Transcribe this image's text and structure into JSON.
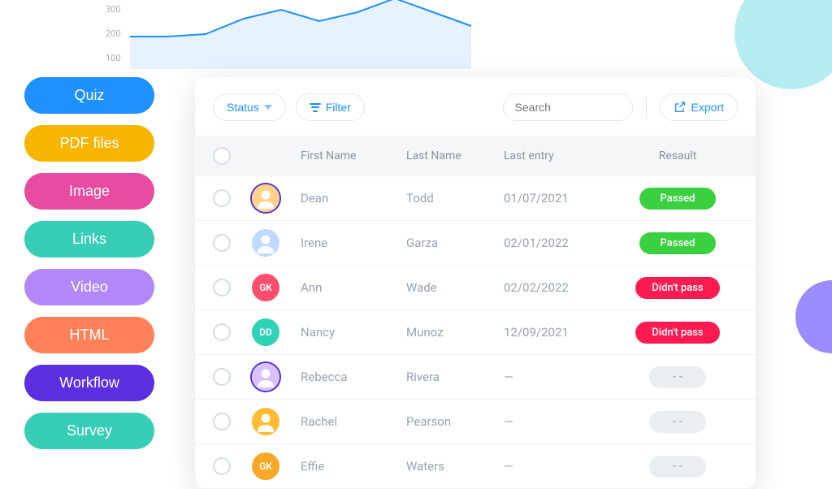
{
  "chart_data": {
    "type": "line",
    "x": [
      0,
      1,
      2,
      3,
      4,
      5,
      6,
      7,
      8,
      9
    ],
    "values": [
      185,
      185,
      195,
      260,
      300,
      250,
      290,
      350,
      290,
      230
    ],
    "ylabel": "",
    "yticks": [
      100,
      200,
      300
    ],
    "ylim": [
      0,
      400
    ],
    "style": "area",
    "color": "#1e90ff"
  },
  "sidebar": {
    "items": [
      {
        "label": "Quiz",
        "color": "#1e90ff"
      },
      {
        "label": "PDF files",
        "color": "#f7b500"
      },
      {
        "label": "Image",
        "color": "#e84ba0"
      },
      {
        "label": "Links",
        "color": "#37cdb7"
      },
      {
        "label": "Video",
        "color": "#b287f7"
      },
      {
        "label": "HTML",
        "color": "#ff8159"
      },
      {
        "label": "Workflow",
        "color": "#5b2fe0"
      },
      {
        "label": "Survey",
        "color": "#37cdb7"
      }
    ]
  },
  "toolbar": {
    "status_label": "Status",
    "filter_label": "Filter",
    "search_placeholder": "Search",
    "export_label": "Export"
  },
  "table": {
    "headers": {
      "first_name": "First Name",
      "last_name": "Last Name",
      "last_entry": "Last entry",
      "result": "Resault"
    },
    "none_badge": "- -",
    "em_dash": "—",
    "rows": [
      {
        "first_name": "Dean",
        "last_name": "Todd",
        "last_entry": "01/07/2021",
        "result": "Passed",
        "result_type": "pass",
        "avatar": {
          "type": "img",
          "ring": true,
          "bg": "#ffd28a"
        }
      },
      {
        "first_name": "Irene",
        "last_name": "Garza",
        "last_entry": "02/01/2022",
        "result": "Passed",
        "result_type": "pass",
        "avatar": {
          "type": "img",
          "bg": "#c0d9ff"
        }
      },
      {
        "first_name": "Ann",
        "last_name": "Wade",
        "last_entry": "02/02/2022",
        "result": "Didn't pass",
        "result_type": "fail",
        "avatar": {
          "type": "initials",
          "text": "GK",
          "bg": "#ff4d6d"
        }
      },
      {
        "first_name": "Nancy",
        "last_name": "Munoz",
        "last_entry": "12/09/2021",
        "result": "Didn't pass",
        "result_type": "fail",
        "avatar": {
          "type": "initials",
          "text": "DD",
          "bg": "#2ed3b7"
        }
      },
      {
        "first_name": "Rebecca",
        "last_name": "Rivera",
        "last_entry": "",
        "result": "",
        "result_type": "none",
        "avatar": {
          "type": "img",
          "ring": true,
          "bg": "#d9c0ff"
        }
      },
      {
        "first_name": "Rachel",
        "last_name": "Pearson",
        "last_entry": "",
        "result": "",
        "result_type": "none",
        "avatar": {
          "type": "img",
          "bg": "#ffbb33"
        }
      },
      {
        "first_name": "Effie",
        "last_name": "Waters",
        "last_entry": "",
        "result": "",
        "result_type": "none",
        "avatar": {
          "type": "initials",
          "text": "GK",
          "bg": "#f7a826"
        }
      }
    ]
  }
}
